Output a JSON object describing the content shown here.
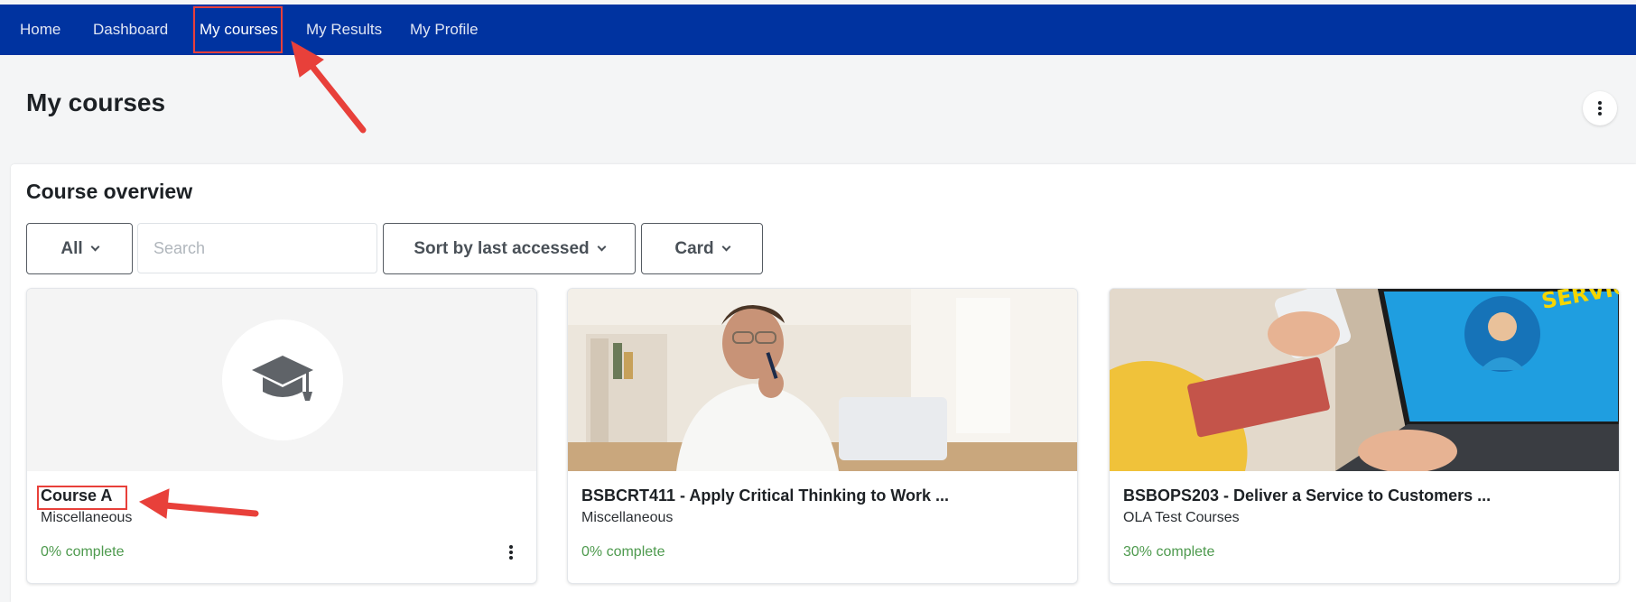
{
  "nav": {
    "items": [
      {
        "label": "Home"
      },
      {
        "label": "Dashboard"
      },
      {
        "label": "My courses"
      },
      {
        "label": "My Results"
      },
      {
        "label": "My Profile"
      }
    ]
  },
  "page": {
    "title": "My courses"
  },
  "overview": {
    "title": "Course overview",
    "filter_label": "All",
    "search_placeholder": "Search",
    "sort_label": "Sort by last accessed",
    "view_label": "Card"
  },
  "courses": [
    {
      "name": "Course A",
      "category": "Miscellaneous",
      "progress": "0% complete",
      "image": "graduation-cap-icon"
    },
    {
      "name": "BSBCRT411 - Apply Critical Thinking to Work ...",
      "category": "Miscellaneous",
      "progress": "0% complete",
      "image": "photo-thinking-man"
    },
    {
      "name": "BSBOPS203 - Deliver a Service to Customers ...",
      "category": "OLA Test Courses",
      "progress": "30% complete",
      "image": "photo-laptop-customer-service"
    }
  ],
  "colors": {
    "navbar": "#0033a0",
    "highlight": "#e8403a",
    "progress": "#4e9a4e"
  }
}
